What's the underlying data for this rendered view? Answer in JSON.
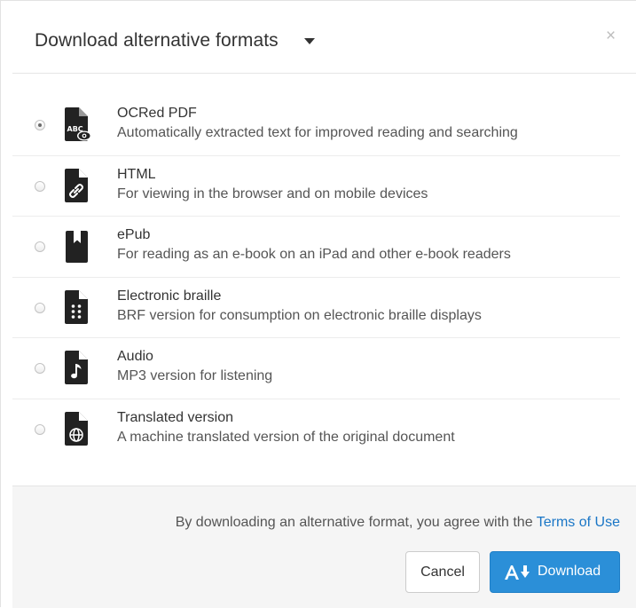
{
  "dialog": {
    "title": "Download alternative formats",
    "close_glyph": "×"
  },
  "formats": [
    {
      "title": "OCRed PDF",
      "description": "Automatically extracted text for improved reading and searching",
      "icon": "ocr-pdf-icon",
      "selected": true
    },
    {
      "title": "HTML",
      "description": "For viewing in the browser and on mobile devices",
      "icon": "html-link-icon",
      "selected": false
    },
    {
      "title": "ePub",
      "description": "For reading as an e-book on an iPad and other e-book readers",
      "icon": "epub-book-icon",
      "selected": false
    },
    {
      "title": "Electronic braille",
      "description": "BRF version for consumption on electronic braille displays",
      "icon": "braille-icon",
      "selected": false
    },
    {
      "title": "Audio",
      "description": "MP3 version for listening",
      "icon": "audio-note-icon",
      "selected": false
    },
    {
      "title": "Translated version",
      "description": "A machine translated version of the original document",
      "icon": "globe-translate-icon",
      "selected": false
    }
  ],
  "footer": {
    "terms_text": "By downloading an alternative format, you agree with the ",
    "terms_link": "Terms of Use",
    "cancel_label": "Cancel",
    "download_label": "Download"
  },
  "colors": {
    "primary": "#2b8fd8",
    "link": "#1a76c6",
    "icon": "#222222"
  }
}
